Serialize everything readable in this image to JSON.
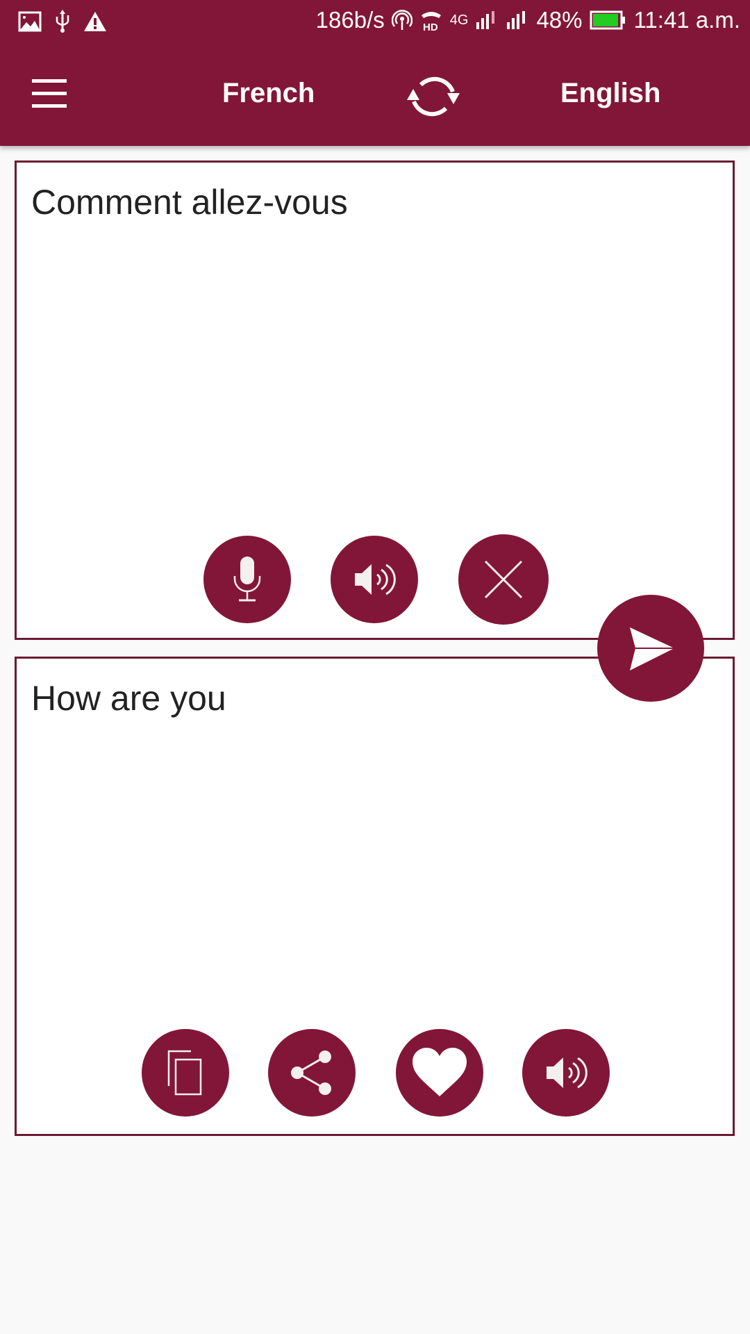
{
  "status_bar": {
    "left_icons": [
      "image-icon",
      "usb-icon",
      "warning-icon"
    ],
    "network_speed": "186b/s",
    "right_icons": [
      "hotspot-icon",
      "hd-call-icon",
      "4g-signal-icon",
      "signal-icon"
    ],
    "network_type": "4G",
    "battery_percent": "48%",
    "battery_level": 0.48,
    "battery_color": "#22cc22",
    "time": "11:41 a.m."
  },
  "toolbar": {
    "menu_icon": "hamburger-menu-icon",
    "source_language": "French",
    "swap_icon": "swap-languages-icon",
    "target_language": "English"
  },
  "input_panel": {
    "text": "Comment allez-vous",
    "buttons": [
      {
        "name": "microphone-button",
        "icon": "microphone-icon"
      },
      {
        "name": "speak-source-button",
        "icon": "speaker-icon"
      },
      {
        "name": "clear-button",
        "icon": "close-icon"
      }
    ]
  },
  "translate_button": {
    "icon": "send-icon"
  },
  "output_panel": {
    "text": "How are you",
    "buttons": [
      {
        "name": "copy-button",
        "icon": "copy-icon"
      },
      {
        "name": "share-button",
        "icon": "share-icon"
      },
      {
        "name": "favorite-button",
        "icon": "heart-icon"
      },
      {
        "name": "speak-translation-button",
        "icon": "speaker-icon"
      }
    ]
  },
  "colors": {
    "primary": "#821638",
    "border": "#6b1a33",
    "background": "#f9f9f9",
    "text": "#222222"
  }
}
